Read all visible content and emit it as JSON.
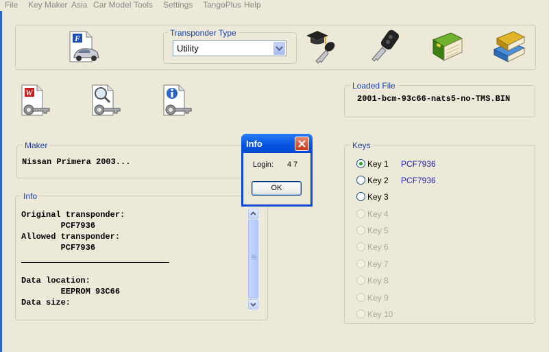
{
  "menu": [
    "File",
    "Key Maker",
    "Asia",
    "Car Model",
    "Tools",
    "Settings",
    "TangoPlus",
    "Help"
  ],
  "transponder_type": {
    "label": "Transponder Type",
    "selected": "Utility"
  },
  "loaded_file": {
    "label": "Loaded File",
    "value": "2001-bcm-93c66-nats5-no-TMS.BIN"
  },
  "maker": {
    "label": "Maker",
    "value": "Nissan Primera 2003..."
  },
  "info": {
    "label": "Info",
    "lines": [
      "Original transponder:",
      "        PCF7936",
      "Allowed transponder:",
      "        PCF7936",
      "",
      "",
      "Data location:",
      "        EEPROM 93C66",
      "Data size:"
    ]
  },
  "keys": {
    "label": "Keys",
    "items": [
      {
        "label": "Key 1",
        "value": "PCF7936",
        "checked": true,
        "enabled": true
      },
      {
        "label": "Key 2",
        "value": "PCF7936",
        "checked": false,
        "enabled": true
      },
      {
        "label": "Key 3",
        "value": "",
        "checked": false,
        "enabled": true
      },
      {
        "label": "Key 4",
        "value": "",
        "checked": false,
        "enabled": false
      },
      {
        "label": "Key 5",
        "value": "",
        "checked": false,
        "enabled": false
      },
      {
        "label": "Key 6",
        "value": "",
        "checked": false,
        "enabled": false
      },
      {
        "label": "Key 7",
        "value": "",
        "checked": false,
        "enabled": false
      },
      {
        "label": "Key 8",
        "value": "",
        "checked": false,
        "enabled": false
      },
      {
        "label": "Key 9",
        "value": "",
        "checked": false,
        "enabled": false
      },
      {
        "label": "Key 10",
        "value": "",
        "checked": false,
        "enabled": false
      }
    ]
  },
  "dialog": {
    "title": "Info",
    "login_label": "Login:",
    "login_value": "4 7",
    "ok_label": "OK"
  },
  "icons": [
    "ford-car-file-icon",
    "graduate-key-icon",
    "car-remote-key-icon",
    "green-book-icon",
    "stacked-books-icon",
    "write-key-icon",
    "search-key-icon",
    "info-key-icon"
  ]
}
